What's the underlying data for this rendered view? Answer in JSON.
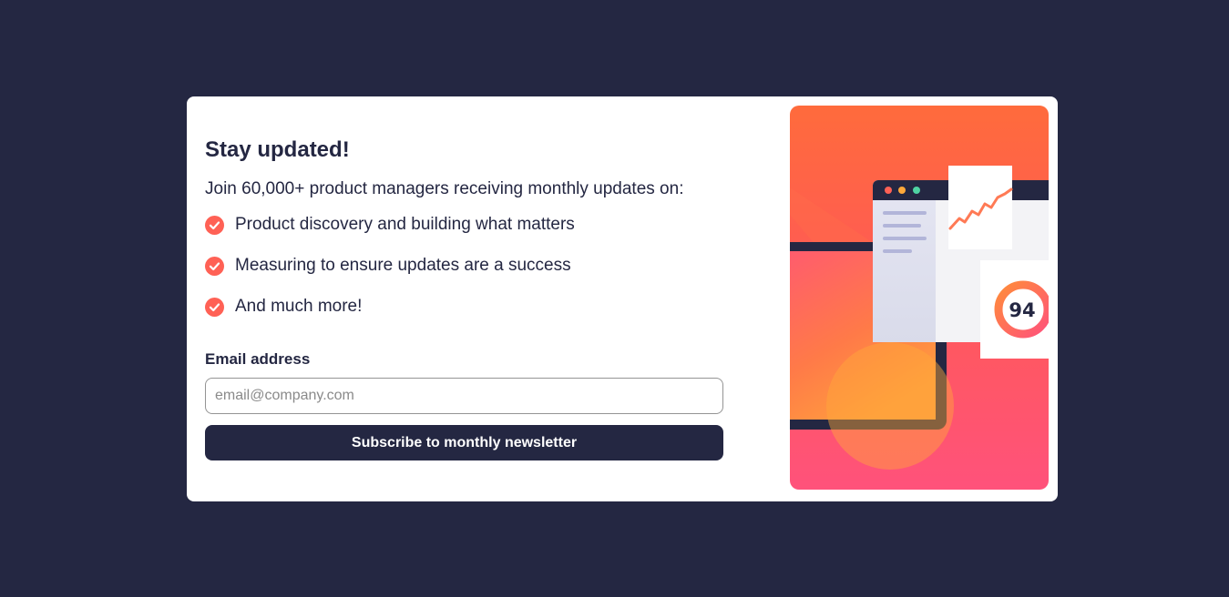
{
  "signup": {
    "title": "Stay updated!",
    "intro": "Join 60,000+ product managers receiving monthly updates on:",
    "features": [
      {
        "icon": "check-icon",
        "text": "Product discovery and building what matters"
      },
      {
        "icon": "check-icon",
        "text": "Measuring to ensure updates are a success"
      },
      {
        "icon": "check-icon",
        "text": "And much more!"
      }
    ],
    "email_label": "Email address",
    "email_placeholder": "email@company.com",
    "email_value": "",
    "button_label": "Subscribe to monthly newsletter"
  },
  "illustration": {
    "score": "94"
  },
  "colors": {
    "page_background": "#242742",
    "card_background": "#ffffff",
    "text": "#242742",
    "accent": "#ff6155",
    "button": "#242742",
    "button_text": "#ffffff",
    "gradient_top": "#ff6a3a",
    "gradient_bottom": "#ff527b"
  }
}
